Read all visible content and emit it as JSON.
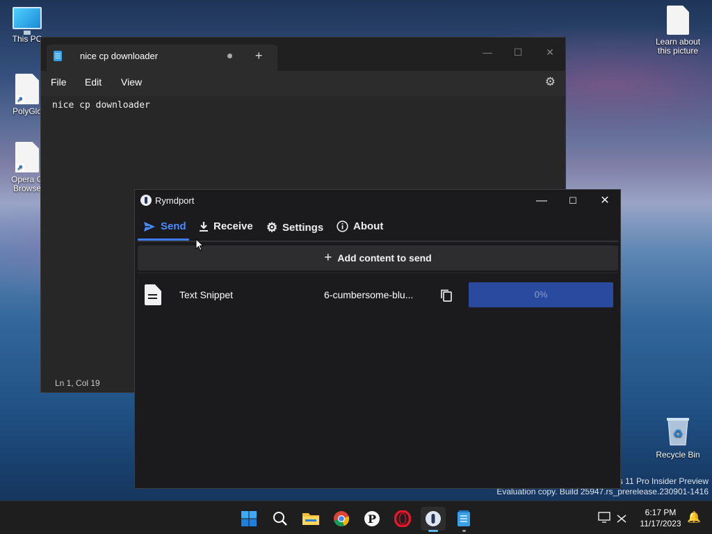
{
  "desktop": {
    "icons": [
      {
        "label": "This PC"
      },
      {
        "label": "PolyGlo"
      },
      {
        "label": "Opera G"
      },
      {
        "label": "Browse"
      },
      {
        "label": "Learn about"
      },
      {
        "label": "this picture"
      },
      {
        "label": "Recycle Bin"
      }
    ],
    "watermark": {
      "line1": "ys 11 Pro Insider Preview",
      "line2": "Evaluation copy. Build 25947.rs_prerelease.230901-1416"
    }
  },
  "notepad": {
    "tab_title": "nice cp downloader",
    "new_tab": "+",
    "menu": [
      "File",
      "Edit",
      "View"
    ],
    "content": "nice cp downloader",
    "status": "Ln 1, Col 19",
    "icons": {
      "minimize": "minimize-icon",
      "maximize": "maximize-icon",
      "close": "close-icon",
      "settings": "gear-icon"
    }
  },
  "rymdport": {
    "title": "Rymdport",
    "tabs": [
      {
        "label": "Send",
        "icon": "send-icon",
        "active": true
      },
      {
        "label": "Receive",
        "icon": "download-icon",
        "active": false
      },
      {
        "label": "Settings",
        "icon": "gear-icon",
        "active": false
      },
      {
        "label": "About",
        "icon": "info-icon",
        "active": false
      }
    ],
    "add_button": "Add content to send",
    "transfer": {
      "kind": "Text Snippet",
      "code": "6-cumbersome-blu...",
      "progress": 0,
      "progress_text": "0%"
    },
    "colors": {
      "accent": "#3d7cf6",
      "progress": "#2a4aa0"
    }
  },
  "taskbar": {
    "apps": [
      "start-icon",
      "search-icon",
      "file-explorer-icon",
      "chrome-icon",
      "p-app-icon",
      "opera-icon",
      "rymdport-icon",
      "notepad-icon"
    ],
    "time": "6:17 PM",
    "date": "11/17/2023"
  }
}
